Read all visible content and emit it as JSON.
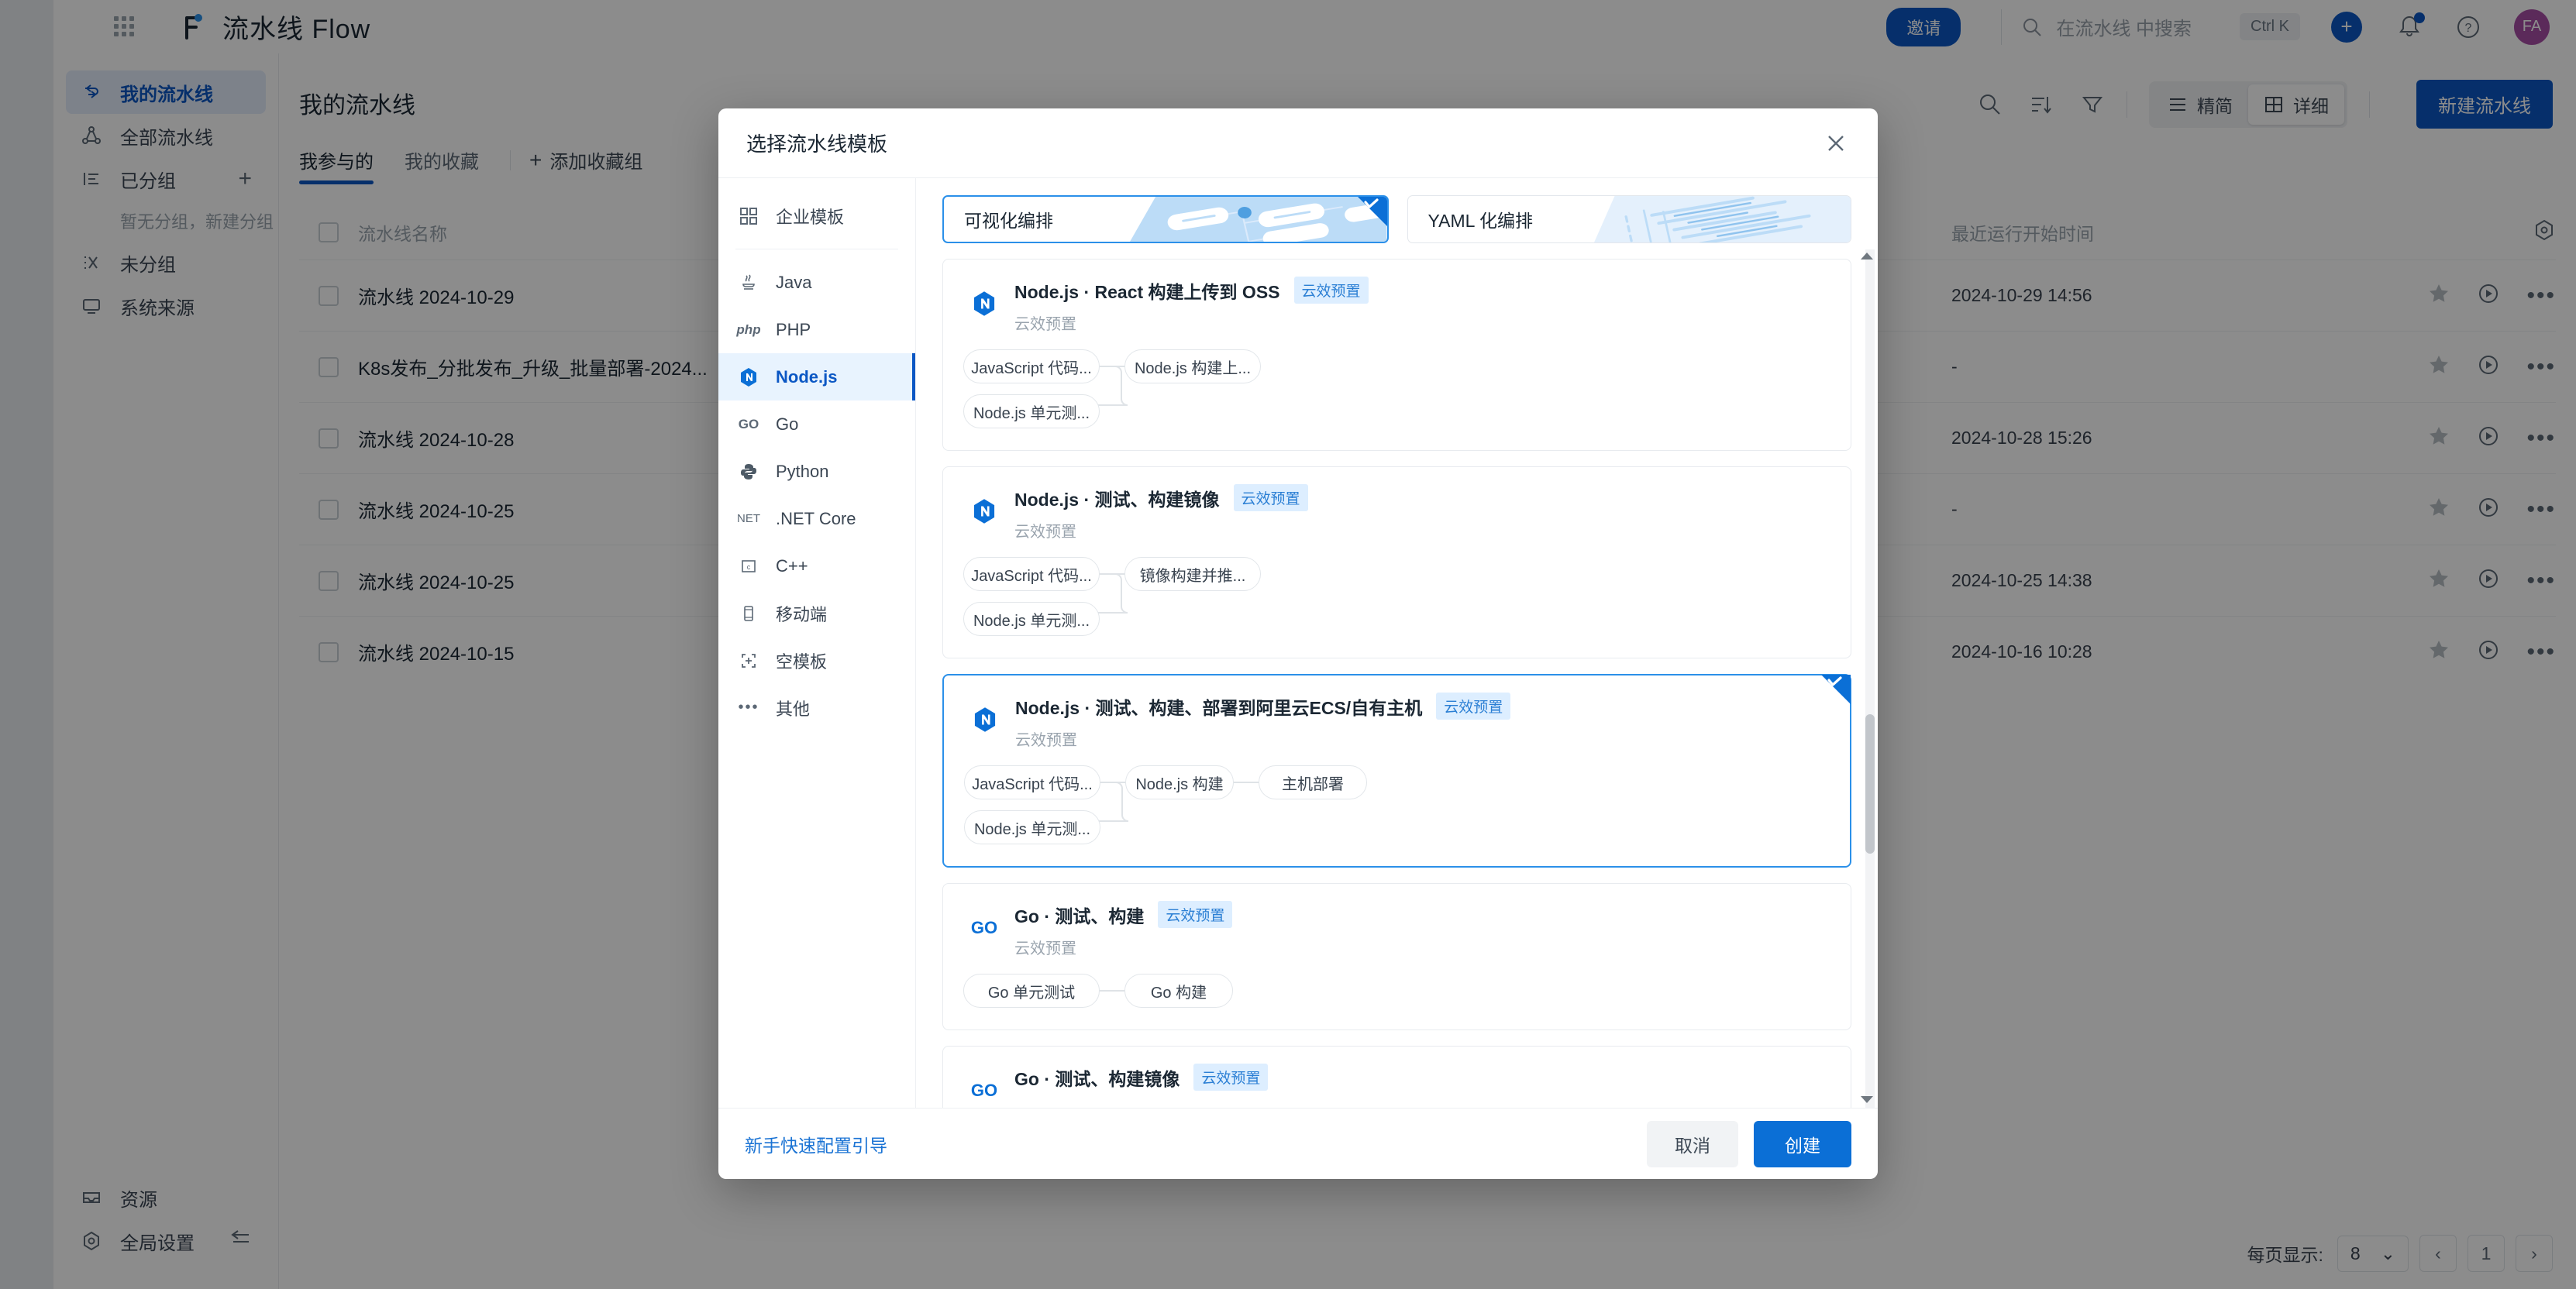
{
  "header": {
    "brand": "流水线 Flow",
    "invite_label": "邀请",
    "search_placeholder": "在流水线 中搜索",
    "shortcut": "Ctrl K",
    "plus_label": "+",
    "avatar_initials": "FA",
    "icons": {
      "apps": "apps-grid-icon",
      "search": "search-icon",
      "bell": "bell-icon",
      "help": "help-circle-icon"
    }
  },
  "sidebar": {
    "items": [
      {
        "label": "我的流水线",
        "icon": "pipeline-icon",
        "active": true
      },
      {
        "label": "全部流水线",
        "icon": "nodes-icon",
        "active": false
      },
      {
        "label": "已分组",
        "icon": "group-list-icon",
        "active": false,
        "action": "+"
      },
      {
        "label": "未分组",
        "icon": "ungrouped-icon",
        "active": false
      },
      {
        "label": "系统来源",
        "icon": "monitor-icon",
        "active": false
      }
    ],
    "empty_group_hint": "暂无分组，新建分组",
    "bottom_items": [
      {
        "label": "资源",
        "icon": "inbox-icon"
      },
      {
        "label": "全局设置",
        "icon": "gear-hex-icon",
        "action": "collapse-icon"
      }
    ]
  },
  "main": {
    "page_title": "我的流水线",
    "tabs": [
      {
        "label": "我参与的",
        "active": true
      },
      {
        "label": "我的收藏",
        "active": false
      }
    ],
    "add_favorite_group": "添加收藏组",
    "toolbar": {
      "icons": [
        "search-icon",
        "sort-icon",
        "filter-icon"
      ],
      "view_simple": "精简",
      "view_detail": "详细",
      "new_pipeline": "新建流水线"
    },
    "table": {
      "columns": [
        "流水线名称",
        "最近运行开始时间"
      ],
      "rows": [
        {
          "name": "流水线 2024-10-29",
          "time": "2024-10-29 14:56"
        },
        {
          "name": "K8s发布_分批发布_升级_批量部署-2024...",
          "time": "-"
        },
        {
          "name": "流水线 2024-10-28",
          "time": "2024-10-28 15:26"
        },
        {
          "name": "流水线 2024-10-25",
          "time": "-"
        },
        {
          "name": "流水线 2024-10-25",
          "time": "2024-10-25 14:38"
        },
        {
          "name": "流水线 2024-10-15",
          "time": "2024-10-16 10:28"
        }
      ]
    },
    "pagination": {
      "per_page_label": "每页显示:",
      "per_page_value": "8",
      "prev": "‹",
      "page": "1",
      "next": "›"
    }
  },
  "modal": {
    "title": "选择流水线模板",
    "close_icon": "close-icon",
    "nav": [
      {
        "label": "企业模板",
        "icon": "enterprise-icon",
        "active": false,
        "separator_after": true
      },
      {
        "label": "Java",
        "icon": "java-icon",
        "active": false
      },
      {
        "label": "PHP",
        "icon": "php-icon",
        "active": false
      },
      {
        "label": "Node.js",
        "icon": "nodejs-icon",
        "active": true
      },
      {
        "label": "Go",
        "icon": "go-icon",
        "active": false
      },
      {
        "label": "Python",
        "icon": "python-icon",
        "active": false
      },
      {
        "label": ".NET Core",
        "icon": "dotnet-icon",
        "active": false
      },
      {
        "label": "C++",
        "icon": "cpp-icon",
        "active": false
      },
      {
        "label": "移动端",
        "icon": "mobile-icon",
        "active": false
      },
      {
        "label": "空模板",
        "icon": "blank-template-icon",
        "active": false
      },
      {
        "label": "其他",
        "icon": "ellipsis-icon",
        "active": false
      }
    ],
    "modes": [
      {
        "label": "可视化编排",
        "selected": true,
        "art": "pipeline-nodes-art"
      },
      {
        "label": "YAML 化编排",
        "selected": false,
        "art": "yaml-lines-art"
      }
    ],
    "templates": [
      {
        "icon": "nodejs-icon",
        "title": "Node.js · React 构建上传到 OSS",
        "badge": "云效预置",
        "subtitle": "云效预置",
        "selected": false,
        "nodes": [
          "JavaScript 代码...",
          "Node.js 单元测...",
          "Node.js 构建上..."
        ]
      },
      {
        "icon": "nodejs-icon",
        "title": "Node.js · 测试、构建镜像",
        "badge": "云效预置",
        "subtitle": "云效预置",
        "selected": false,
        "nodes": [
          "JavaScript 代码...",
          "Node.js 单元测...",
          "镜像构建并推..."
        ]
      },
      {
        "icon": "nodejs-icon",
        "title": "Node.js · 测试、构建、部署到阿里云ECS/自有主机",
        "badge": "云效预置",
        "subtitle": "云效预置",
        "selected": true,
        "nodes": [
          "JavaScript 代码...",
          "Node.js 单元测...",
          "Node.js 构建",
          "主机部署"
        ]
      },
      {
        "icon": "go-icon",
        "title": "Go · 测试、构建",
        "badge": "云效预置",
        "subtitle": "云效预置",
        "selected": false,
        "nodes": [
          "Go 单元测试",
          "Go 构建"
        ]
      },
      {
        "icon": "go-icon",
        "title": "Go · 测试、构建镜像",
        "badge": "云效预置",
        "subtitle": "",
        "selected": false,
        "nodes": []
      }
    ],
    "footer": {
      "guide_link": "新手快速配置引导",
      "cancel": "取消",
      "create": "创建"
    }
  },
  "colors": {
    "brand_blue": "#0b57c4",
    "accent_blue": "#2b90e9",
    "badge_bg": "#ddeeff",
    "badge_text": "#2b7fd4"
  }
}
